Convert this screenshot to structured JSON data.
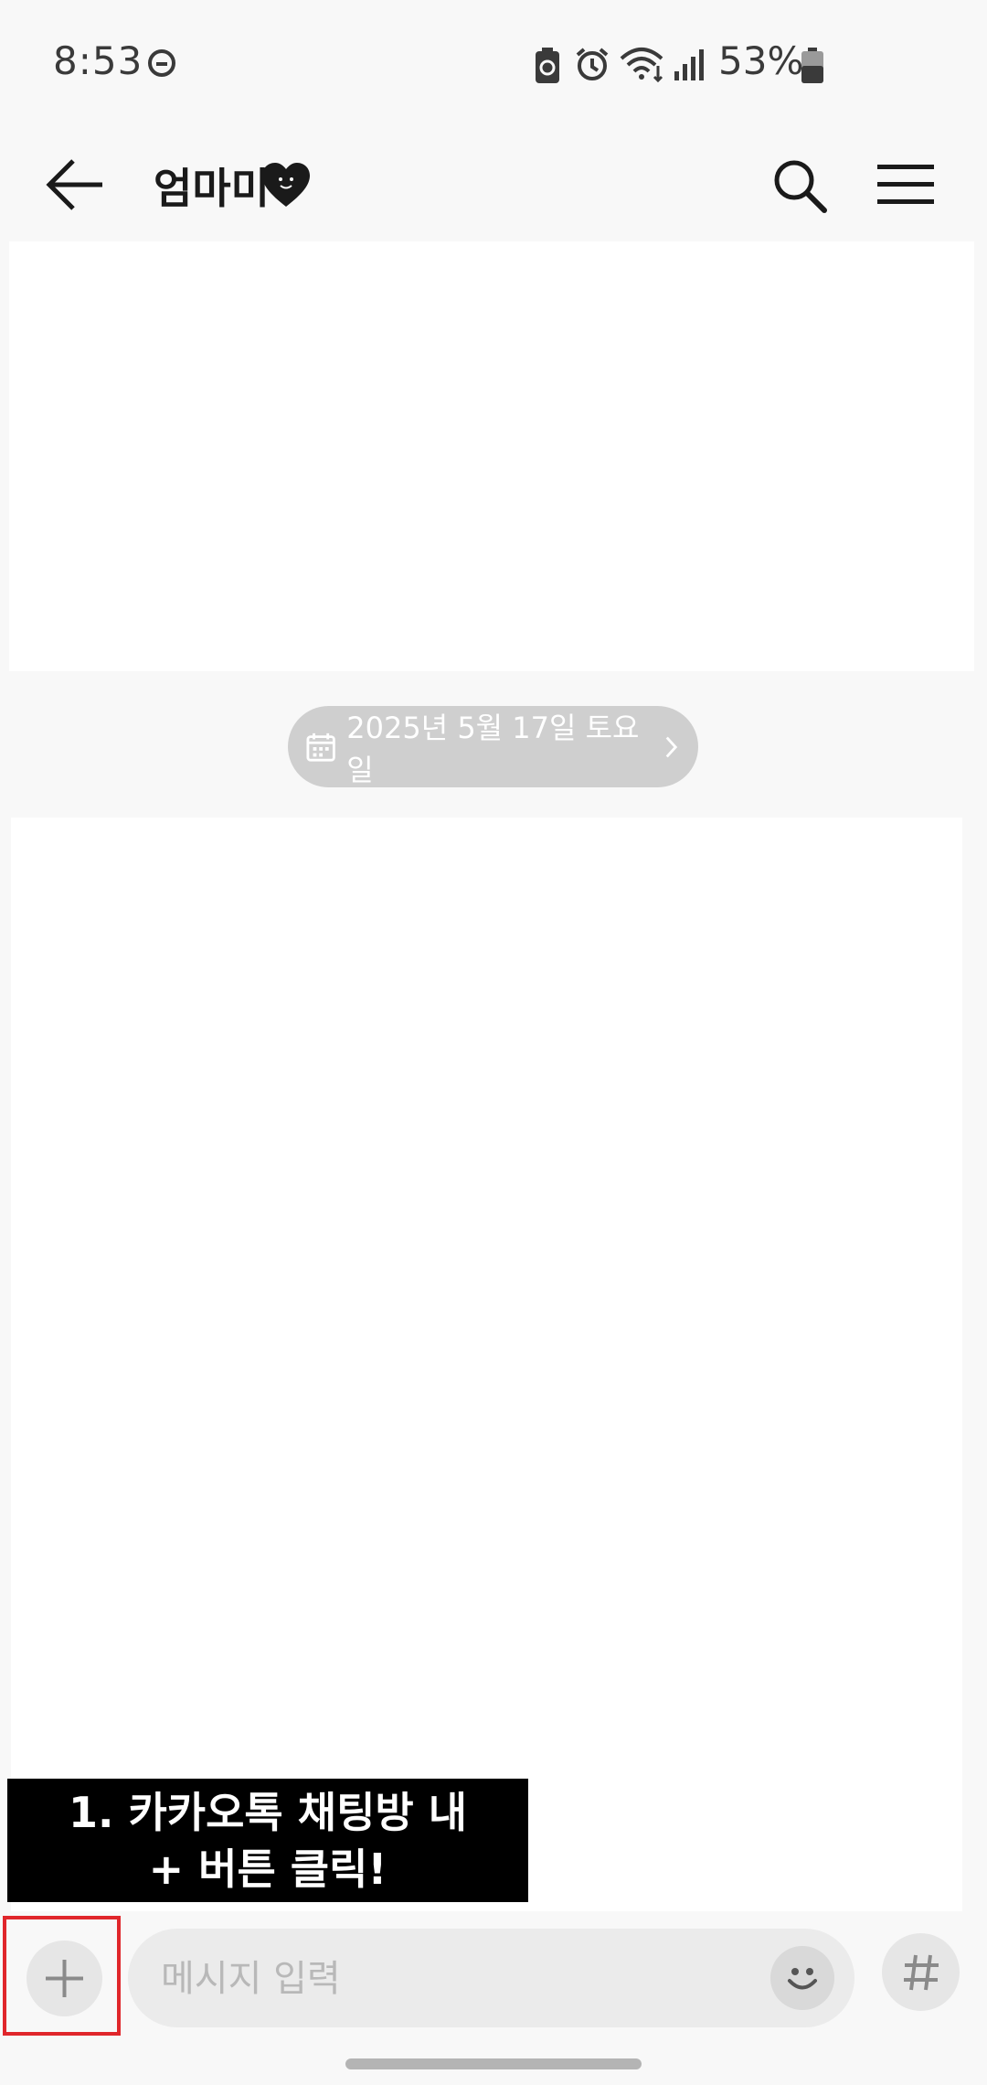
{
  "status_bar": {
    "time": "8:53",
    "battery_percent": "53%"
  },
  "header": {
    "title": "엄마미"
  },
  "chat": {
    "date_label": "2025년 5월 17일 토요일"
  },
  "overlay": {
    "instruction_line1": "1. 카카오톡 채팅방 내",
    "instruction_line2": "+ 버튼 클릭!"
  },
  "input": {
    "placeholder": "메시지 입력"
  },
  "colors": {
    "highlight": "#e0262b",
    "date_pill": "#cfcfcf",
    "banner": "#000000"
  }
}
